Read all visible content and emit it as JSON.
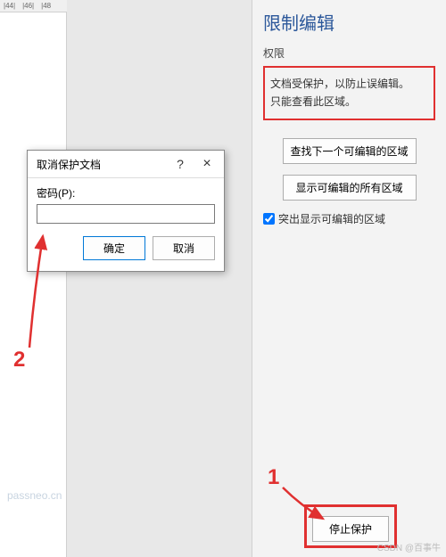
{
  "ruler": {
    "marks": [
      "|44|",
      "|46|",
      "|48"
    ]
  },
  "panel": {
    "title": "限制编辑",
    "perm_label": "权限",
    "perm_text1": "文档受保护，以防止误编辑。",
    "perm_text2": "只能查看此区域。",
    "btn_find": "查找下一个可编辑的区域",
    "btn_show": "显示可编辑的所有区域",
    "chk_label": "突出显示可编辑的区域",
    "stop": "停止保护"
  },
  "dialog": {
    "title": "取消保护文档",
    "help": "?",
    "close": "×",
    "label": "密码(P):",
    "value": "",
    "ok": "确定",
    "cancel": "取消"
  },
  "anno": {
    "one": "1",
    "two": "2"
  },
  "watermark": "passneo.cn",
  "csdn": "CSDN @百事牛"
}
